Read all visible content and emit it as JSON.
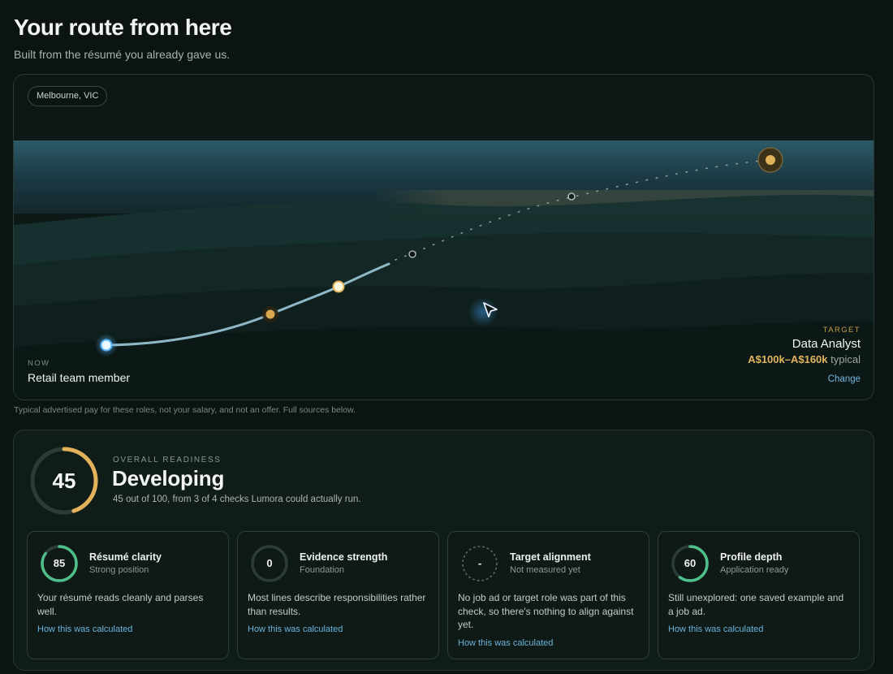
{
  "header": {
    "title": "Your route from here",
    "subtitle": "Built from the résumé you already gave us."
  },
  "route": {
    "location": "Melbourne, VIC",
    "now": {
      "kicker": "NOW",
      "role": "Retail team member"
    },
    "target": {
      "kicker": "TARGET",
      "role": "Data Analyst",
      "pay_range": "A$100k–A$160k",
      "pay_suffix": "typical",
      "change_label": "Change"
    },
    "footnote": "Typical advertised pay for these roles, not your salary, and not an offer. Full sources below.",
    "colors": {
      "progress_line": "#8fb8c6",
      "milestone": "#e2b35a",
      "start": "#bfe6ff",
      "target": "#e2b35a"
    }
  },
  "readiness": {
    "kicker": "OVERALL READINESS",
    "status": "Developing",
    "score": 45,
    "score_label": "45",
    "max": 100,
    "description": "45 out of 100, from 3 of 4 checks Lumora could actually run.",
    "ring_color": "#e2b35a",
    "checks": [
      {
        "title": "Résumé clarity",
        "subtitle": "Strong position",
        "score": 85,
        "score_label": "85",
        "measured": true,
        "body": "Your résumé reads cleanly and parses well.",
        "link": "How this was calculated"
      },
      {
        "title": "Evidence strength",
        "subtitle": "Foundation",
        "score": 0,
        "score_label": "0",
        "measured": true,
        "body": "Most lines describe responsibilities rather than results.",
        "link": "How this was calculated"
      },
      {
        "title": "Target alignment",
        "subtitle": "Not measured yet",
        "score": null,
        "score_label": "-",
        "measured": false,
        "body": "No job ad or target role was part of this check, so there's nothing to align against yet.",
        "link": "How this was calculated"
      },
      {
        "title": "Profile depth",
        "subtitle": "Application ready",
        "score": 60,
        "score_label": "60",
        "measured": true,
        "body": "Still unexplored: one saved example and a job ad.",
        "link": "How this was calculated"
      }
    ],
    "check_ring_color": "#4fbf8a"
  }
}
